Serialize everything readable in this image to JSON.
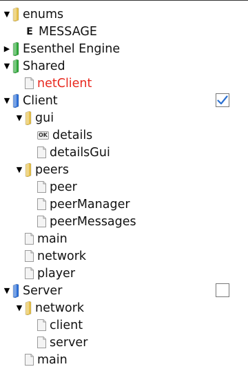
{
  "tree": [
    {
      "label": "enums",
      "icon": "folder-yellow",
      "arrow": "down",
      "depth": 0
    },
    {
      "label": "MESSAGE",
      "icon": "enum",
      "arrow": "none",
      "depth": 1
    },
    {
      "label": "Esenthel Engine",
      "icon": "folder-green",
      "arrow": "right",
      "depth": 0
    },
    {
      "label": "Shared",
      "icon": "folder-green",
      "arrow": "down",
      "depth": 0
    },
    {
      "label": "netClient",
      "icon": "file",
      "arrow": "none",
      "depth": 1,
      "color": "red"
    },
    {
      "label": "Client",
      "icon": "folder-blue",
      "arrow": "down",
      "depth": 0,
      "checkbox": true,
      "checked": true
    },
    {
      "label": "gui",
      "icon": "folder-yellow",
      "arrow": "down",
      "depth": 1
    },
    {
      "label": "details",
      "icon": "ok",
      "arrow": "none",
      "depth": 2
    },
    {
      "label": "detailsGui",
      "icon": "file",
      "arrow": "none",
      "depth": 2
    },
    {
      "label": "peers",
      "icon": "folder-yellow",
      "arrow": "down",
      "depth": 1
    },
    {
      "label": "peer",
      "icon": "file",
      "arrow": "none",
      "depth": 2
    },
    {
      "label": "peerManager",
      "icon": "file",
      "arrow": "none",
      "depth": 2
    },
    {
      "label": "peerMessages",
      "icon": "file",
      "arrow": "none",
      "depth": 2
    },
    {
      "label": "main",
      "icon": "file",
      "arrow": "none",
      "depth": 1
    },
    {
      "label": "network",
      "icon": "file",
      "arrow": "none",
      "depth": 1
    },
    {
      "label": "player",
      "icon": "file",
      "arrow": "none",
      "depth": 1
    },
    {
      "label": "Server",
      "icon": "folder-blue",
      "arrow": "down",
      "depth": 0,
      "checkbox": true,
      "checked": false
    },
    {
      "label": "network",
      "icon": "folder-yellow",
      "arrow": "down",
      "depth": 1
    },
    {
      "label": "client",
      "icon": "file",
      "arrow": "none",
      "depth": 2
    },
    {
      "label": "server",
      "icon": "file",
      "arrow": "none",
      "depth": 2
    },
    {
      "label": "main",
      "icon": "file",
      "arrow": "none",
      "depth": 1
    }
  ],
  "ok_icon_text": "OK",
  "enum_icon_text": "E",
  "colors": {
    "folder_yellow": "#e6c04a",
    "folder_green": "#2fa83a",
    "folder_blue": "#2d6fd6",
    "red_text": "#e8281e",
    "checkmark": "#2a6fd0"
  }
}
